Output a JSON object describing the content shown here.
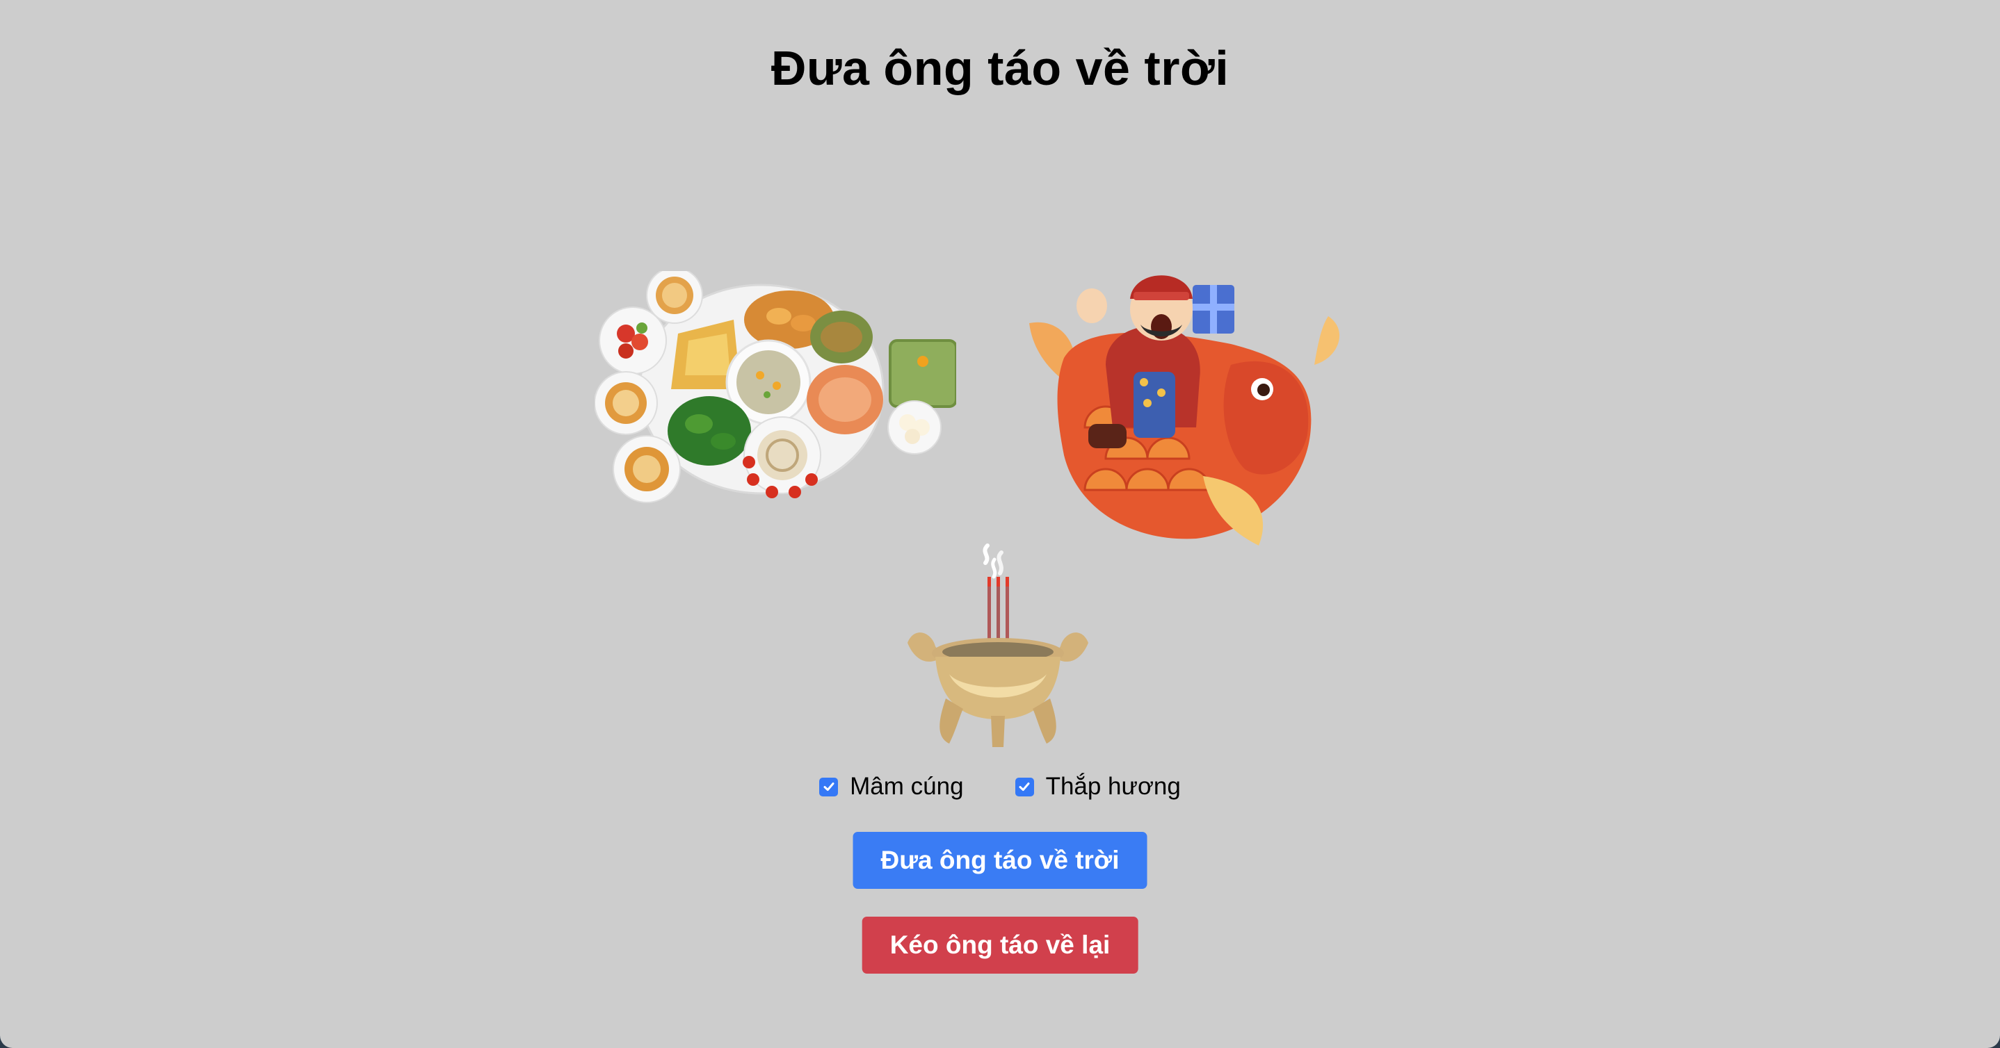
{
  "title": "Đưa ông táo về trời",
  "images": [
    {
      "name": "mam-cung-image",
      "icon": "food-tray-icon"
    },
    {
      "name": "ong-tao-image",
      "icon": "kitchen-god-on-carp-icon"
    },
    {
      "name": "incense-burner-image",
      "icon": "incense-burner-icon"
    }
  ],
  "options": {
    "mam_cung": {
      "label": "Mâm cúng",
      "checked": true
    },
    "thap_huong": {
      "label": "Thắp hương",
      "checked": true
    }
  },
  "buttons": {
    "send_label": "Đưa ông táo về trời",
    "back_label": "Kéo ông táo về lại"
  },
  "colors": {
    "background": "#cdcdcd",
    "primary": "#3a7cf4",
    "danger": "#d1404c",
    "checkbox": "#3478f6"
  }
}
